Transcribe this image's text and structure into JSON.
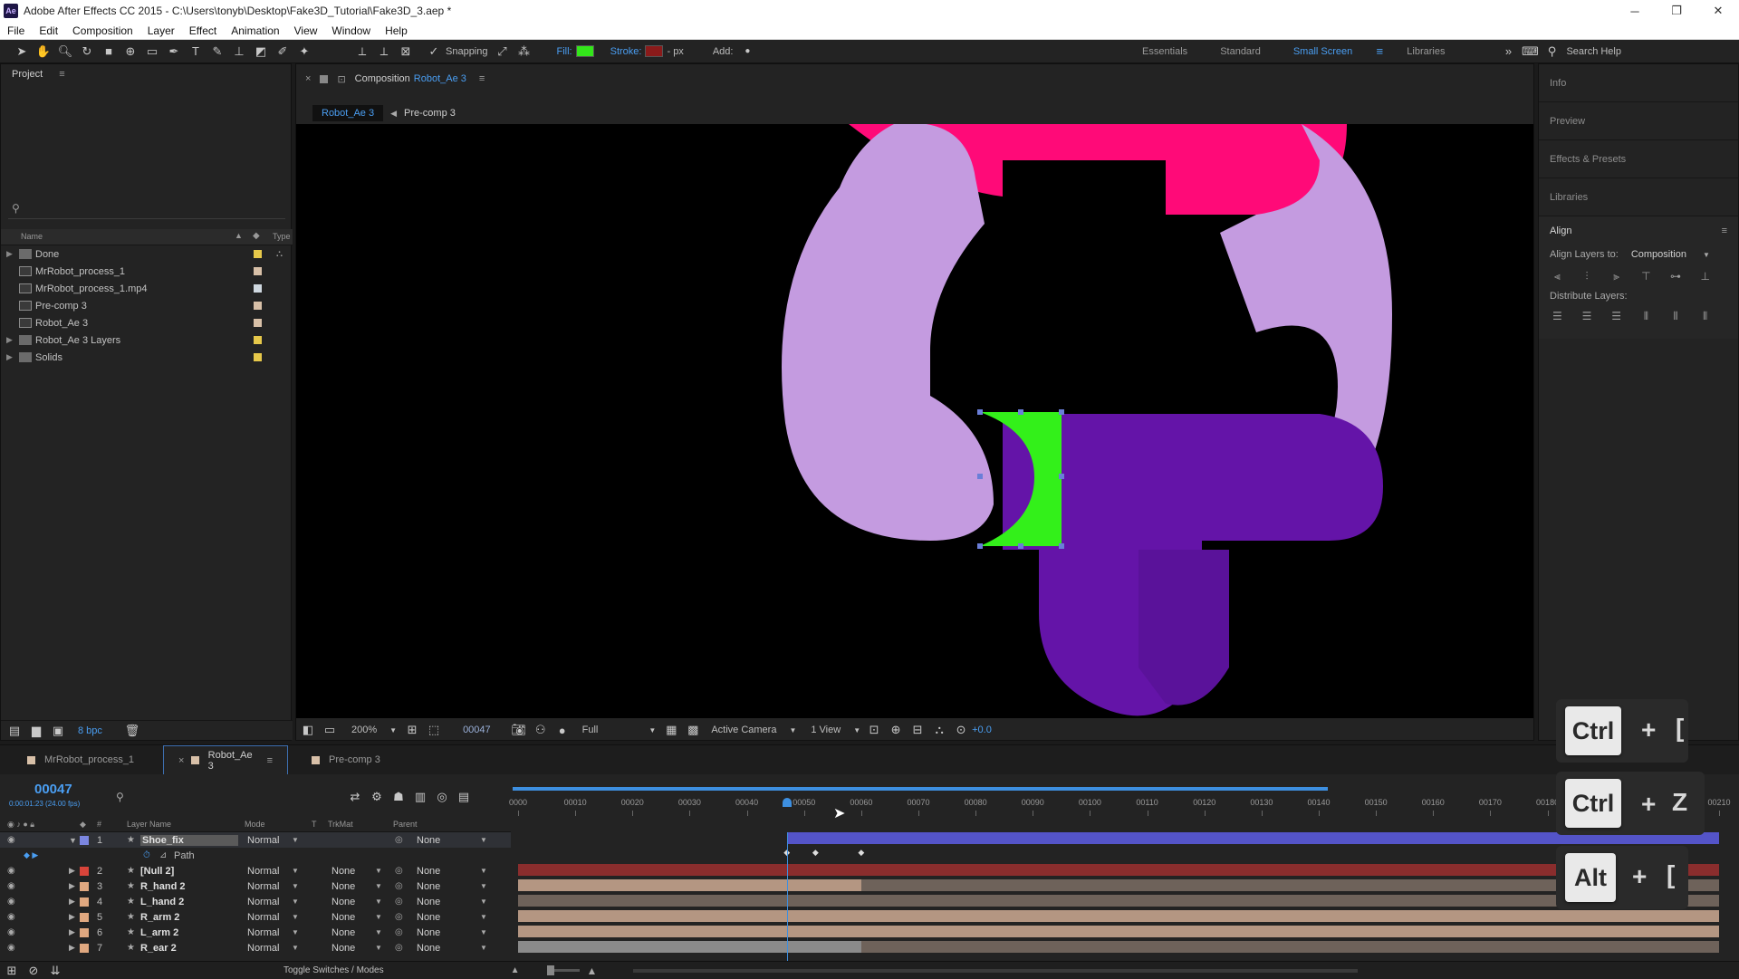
{
  "window": {
    "title": "Adobe After Effects CC 2015 - C:\\Users\\tonyb\\Desktop\\Fake3D_Tutorial\\Fake3D_3.aep *",
    "app_icon_text": "Ae",
    "minimize": "─",
    "maximize": "❐",
    "close": "✕"
  },
  "menu": [
    "File",
    "Edit",
    "Composition",
    "Layer",
    "Effect",
    "Animation",
    "View",
    "Window",
    "Help"
  ],
  "toolbar": {
    "snapping_label": "Snapping",
    "fill_label": "Fill:",
    "fill_color": "#33e61a",
    "stroke_label": "Stroke:",
    "stroke_color": "#8a1a1a",
    "stroke_unit": "- px",
    "add_label": "Add:",
    "workspaces": [
      "Essentials",
      "Standard",
      "Small Screen",
      "Libraries"
    ],
    "active_workspace": "Small Screen",
    "search_help": "Search Help"
  },
  "project": {
    "title": "Project",
    "search_icon": "search-icon",
    "columns": {
      "name": "Name",
      "type": "Type"
    },
    "items": [
      {
        "label": "Done",
        "kind": "folder",
        "chip": "#e6c84a"
      },
      {
        "label": "MrRobot_process_1",
        "kind": "comp",
        "chip": "#d8c0a8"
      },
      {
        "label": "MrRobot_process_1.mp4",
        "kind": "footage",
        "chip": "#cfd8e0"
      },
      {
        "label": "Pre-comp 3",
        "kind": "comp",
        "chip": "#d8c0a8"
      },
      {
        "label": "Robot_Ae 3",
        "kind": "comp",
        "chip": "#d8c0a8"
      },
      {
        "label": "Robot_Ae 3 Layers",
        "kind": "folder",
        "chip": "#e6c84a"
      },
      {
        "label": "Solids",
        "kind": "folder",
        "chip": "#e6c84a"
      }
    ],
    "bpc": "8 bpc"
  },
  "composition": {
    "panel_label": "Composition",
    "comp_name": "Robot_Ae 3",
    "breadcrumb_active": "Robot_Ae 3",
    "breadcrumb_next": "Pre-comp 3",
    "zoom": "200%",
    "timecode": "00047",
    "resolution": "Full",
    "camera": "Active Camera",
    "views": "1 View",
    "exposure": "+0.0"
  },
  "right_panels": {
    "items": [
      "Info",
      "Preview",
      "Effects & Presets",
      "Libraries"
    ],
    "align_title": "Align",
    "align_layers_to": "Align Layers to:",
    "align_target": "Composition",
    "distribute_layers": "Distribute Layers:"
  },
  "timeline": {
    "tabs": [
      {
        "label": "MrRobot_process_1",
        "chip": "#d8c0a8",
        "active": false
      },
      {
        "label": "Robot_Ae 3",
        "chip": "#d8c0a8",
        "active": true
      },
      {
        "label": "Pre-comp 3",
        "chip": "#d8c0a8",
        "active": false
      }
    ],
    "timecode": "00047",
    "timecode_sub": "0:00:01:23 (24.00 fps)",
    "columns": {
      "layer_name": "Layer Name",
      "mode": "Mode",
      "t": "T",
      "trkmat": "TrkMat",
      "parent": "Parent"
    },
    "ruler_labels": [
      "0000",
      "00010",
      "00020",
      "00030",
      "00040",
      "00050",
      "00060",
      "00070",
      "00080",
      "00090",
      "00100",
      "00110",
      "00120",
      "00130",
      "00140",
      "00150",
      "00160",
      "00170",
      "00180",
      "00190",
      "00200",
      "00210"
    ],
    "current_frame": 47,
    "frame_max": 210,
    "layers": [
      {
        "num": "1",
        "name": "Shoe_fix",
        "mode": "Normal",
        "trkmat": "",
        "parent": "None",
        "chip": "#7b86e0",
        "selected": true
      },
      {
        "num": "",
        "name": "Path",
        "sub": true
      },
      {
        "num": "2",
        "name": "[Null 2]",
        "mode": "Normal",
        "trkmat": "None",
        "parent": "None",
        "chip": "#d8443a"
      },
      {
        "num": "3",
        "name": "R_hand 2",
        "mode": "Normal",
        "trkmat": "None",
        "parent": "None",
        "chip": "#e0a880"
      },
      {
        "num": "4",
        "name": "L_hand 2",
        "mode": "Normal",
        "trkmat": "None",
        "parent": "None",
        "chip": "#e0a880"
      },
      {
        "num": "5",
        "name": "R_arm 2",
        "mode": "Normal",
        "trkmat": "None",
        "parent": "None",
        "chip": "#e0a880"
      },
      {
        "num": "6",
        "name": "L_arm 2",
        "mode": "Normal",
        "trkmat": "None",
        "parent": "None",
        "chip": "#e0a880"
      },
      {
        "num": "7",
        "name": "R_ear 2",
        "mode": "Normal",
        "trkmat": "None",
        "parent": "None",
        "chip": "#e0a880"
      }
    ],
    "toggle_label": "Toggle Switches / Modes"
  },
  "shortcuts": [
    {
      "key": "Ctrl",
      "plus": "+",
      "second": "["
    },
    {
      "key": "Ctrl",
      "plus": "+",
      "second": "Z"
    },
    {
      "key": "Alt",
      "plus": "+",
      "second": "["
    }
  ],
  "colors": {
    "head_pink": "#ff0a78",
    "body_lilac": "#c49be0",
    "limb_purple": "#6414a8",
    "shoe_green": "#33f01a",
    "ruler_blue": "#3d8fe0",
    "layer_bar_blue": "#5454c8",
    "layer_bar_red": "#8a2d2d",
    "layer_bar_tan": "#b49682"
  }
}
